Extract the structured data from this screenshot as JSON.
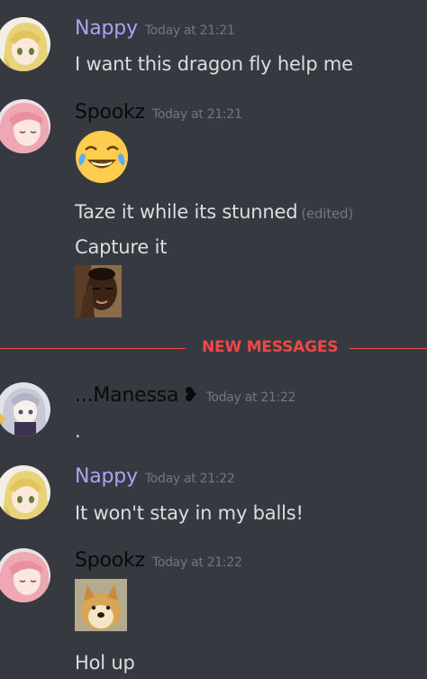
{
  "messages": [
    {
      "author": "Nappy",
      "author_color": "#a3a6fa",
      "timestamp": "Today at 21:21",
      "lines": [
        "I want this dragon fly help me"
      ]
    },
    {
      "author": "Spookz",
      "author_color": "#0a0a0a",
      "timestamp": "Today at 21:21",
      "emoji": "joy-emoji",
      "lines": [
        "Taze it while its stunned",
        "Capture it"
      ],
      "edited_label": "(edited)",
      "attachment": "roll-safe-meme-image"
    },
    {
      "author": "...Manessa",
      "author_color": "#0a0a0a",
      "author_suffix": "❥",
      "timestamp": "Today at 21:22",
      "lines": [
        "."
      ]
    },
    {
      "author": "Nappy",
      "author_color": "#a3a6fa",
      "timestamp": "Today at 21:22",
      "lines": [
        "It won't stay in my balls!"
      ]
    },
    {
      "author": "Spookz",
      "author_color": "#0a0a0a",
      "timestamp": "Today at 21:22",
      "attachment": "doge-image",
      "lines": [
        "Hol up"
      ]
    }
  ],
  "divider": {
    "label": "NEW MESSAGES",
    "color": "#f04747"
  },
  "colors": {
    "background": "#36393f",
    "text": "#dcddde",
    "muted": "#72767d"
  }
}
